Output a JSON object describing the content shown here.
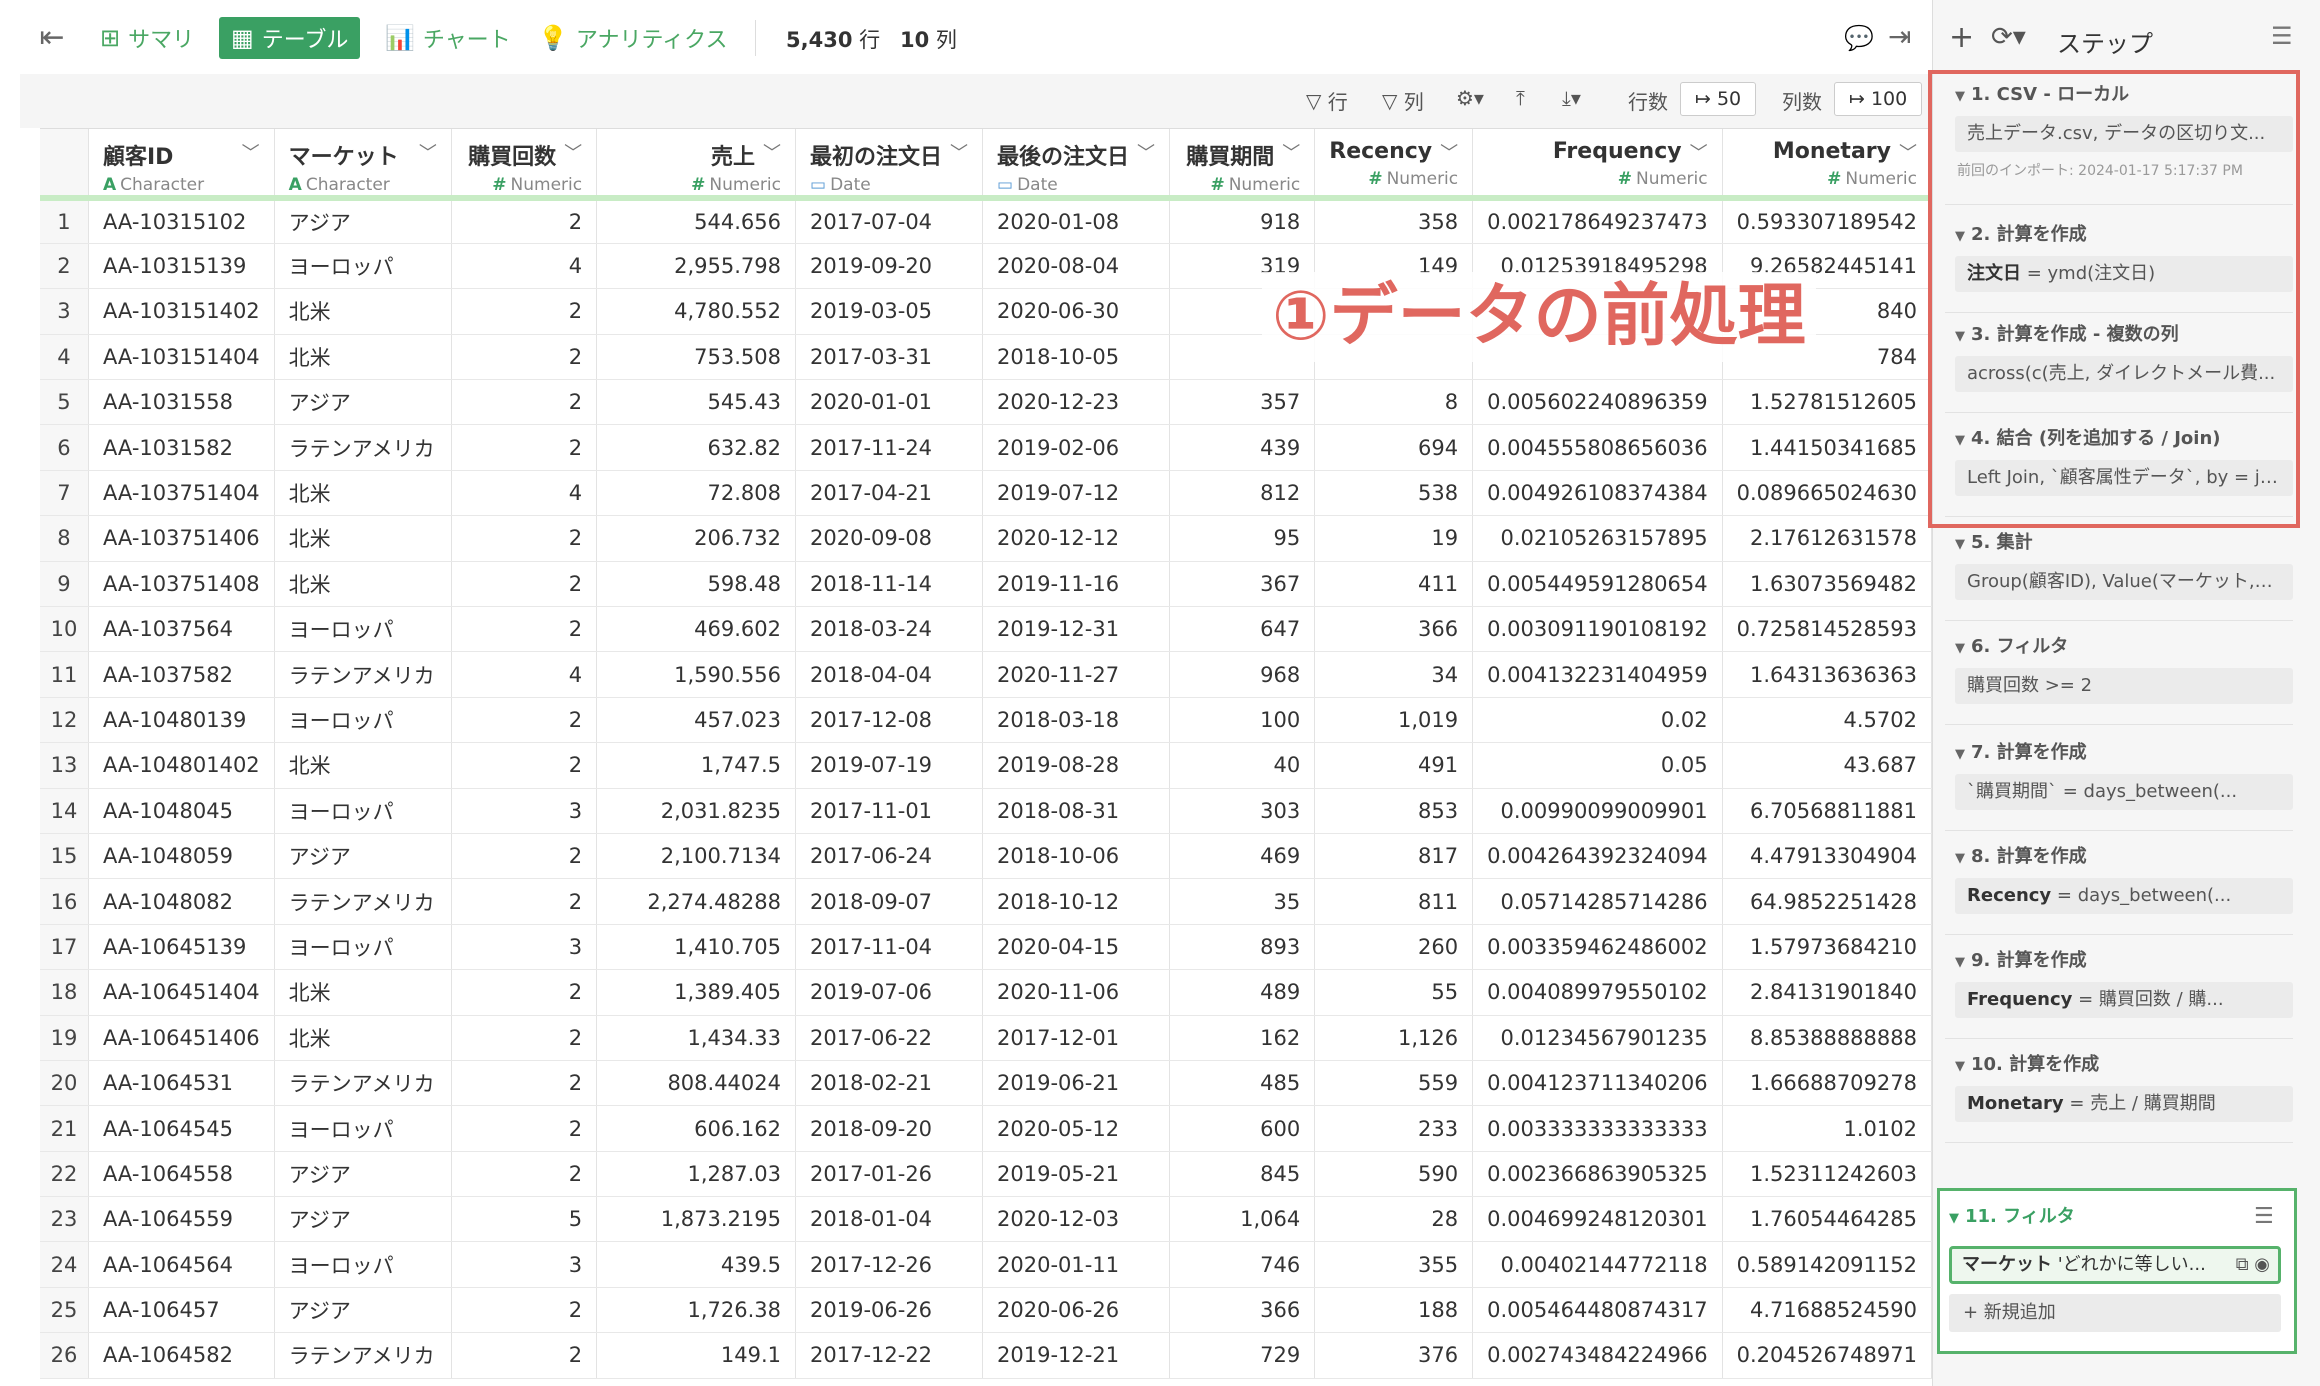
{
  "toolbar": {
    "tabs": [
      {
        "label": "サマリ",
        "icon": "summary-grid-icon"
      },
      {
        "label": "テーブル",
        "icon": "table-icon"
      },
      {
        "label": "チャート",
        "icon": "bar-chart-icon"
      },
      {
        "label": "アナリティクス",
        "icon": "lightbulb-icon"
      }
    ],
    "row_count": "5,430",
    "row_unit": "行",
    "col_count": "10",
    "col_unit": "列"
  },
  "subbar": {
    "row_filter": "行",
    "col_filter": "列",
    "rows_label": "行数",
    "rows_value": "50",
    "cols_label": "列数",
    "cols_value": "100"
  },
  "table": {
    "columns": [
      {
        "name": "顧客ID",
        "type": "Character",
        "num": false
      },
      {
        "name": "マーケット",
        "type": "Character",
        "num": false
      },
      {
        "name": "購買回数",
        "type": "Numeric",
        "num": true
      },
      {
        "name": "売上",
        "type": "Numeric",
        "num": true
      },
      {
        "name": "最初の注文日",
        "type": "Date",
        "num": false
      },
      {
        "name": "最後の注文日",
        "type": "Date",
        "num": false
      },
      {
        "name": "購買期間",
        "type": "Numeric",
        "num": true
      },
      {
        "name": "Recency",
        "type": "Numeric",
        "num": true
      },
      {
        "name": "Frequency",
        "type": "Numeric",
        "num": true
      },
      {
        "name": "Monetary",
        "type": "Numeric",
        "num": true
      }
    ],
    "rows": [
      [
        "1",
        "AA-10315102",
        "アジア",
        "2",
        "544.656",
        "2017-07-04",
        "2020-01-08",
        "918",
        "358",
        "0.002178649237473",
        "0.593307189542"
      ],
      [
        "2",
        "AA-10315139",
        "ヨーロッパ",
        "4",
        "2,955.798",
        "2019-09-20",
        "2020-08-04",
        "319",
        "149",
        "0.01253918495298",
        "9.26582445141"
      ],
      [
        "3",
        "AA-103151402",
        "北米",
        "2",
        "4,780.552",
        "2019-03-05",
        "2020-06-30",
        "",
        "",
        "",
        "840"
      ],
      [
        "4",
        "AA-103151404",
        "北米",
        "2",
        "753.508",
        "2017-03-31",
        "2018-10-05",
        "",
        "",
        "",
        "784"
      ],
      [
        "5",
        "AA-1031558",
        "アジア",
        "2",
        "545.43",
        "2020-01-01",
        "2020-12-23",
        "357",
        "8",
        "0.005602240896359",
        "1.52781512605"
      ],
      [
        "6",
        "AA-1031582",
        "ラテンアメリカ",
        "2",
        "632.82",
        "2017-11-24",
        "2019-02-06",
        "439",
        "694",
        "0.004555808656036",
        "1.44150341685"
      ],
      [
        "7",
        "AA-103751404",
        "北米",
        "4",
        "72.808",
        "2017-04-21",
        "2019-07-12",
        "812",
        "538",
        "0.004926108374384",
        "0.089665024630"
      ],
      [
        "8",
        "AA-103751406",
        "北米",
        "2",
        "206.732",
        "2020-09-08",
        "2020-12-12",
        "95",
        "19",
        "0.02105263157895",
        "2.17612631578"
      ],
      [
        "9",
        "AA-103751408",
        "北米",
        "2",
        "598.48",
        "2018-11-14",
        "2019-11-16",
        "367",
        "411",
        "0.005449591280654",
        "1.63073569482"
      ],
      [
        "10",
        "AA-1037564",
        "ヨーロッパ",
        "2",
        "469.602",
        "2018-03-24",
        "2019-12-31",
        "647",
        "366",
        "0.003091190108192",
        "0.725814528593"
      ],
      [
        "11",
        "AA-1037582",
        "ラテンアメリカ",
        "4",
        "1,590.556",
        "2018-04-04",
        "2020-11-27",
        "968",
        "34",
        "0.004132231404959",
        "1.64313636363"
      ],
      [
        "12",
        "AA-10480139",
        "ヨーロッパ",
        "2",
        "457.023",
        "2017-12-08",
        "2018-03-18",
        "100",
        "1,019",
        "0.02",
        "4.5702"
      ],
      [
        "13",
        "AA-104801402",
        "北米",
        "2",
        "1,747.5",
        "2019-07-19",
        "2019-08-28",
        "40",
        "491",
        "0.05",
        "43.687"
      ],
      [
        "14",
        "AA-1048045",
        "ヨーロッパ",
        "3",
        "2,031.8235",
        "2017-11-01",
        "2018-08-31",
        "303",
        "853",
        "0.00990099009901",
        "6.70568811881"
      ],
      [
        "15",
        "AA-1048059",
        "アジア",
        "2",
        "2,100.7134",
        "2017-06-24",
        "2018-10-06",
        "469",
        "817",
        "0.004264392324094",
        "4.47913304904"
      ],
      [
        "16",
        "AA-1048082",
        "ラテンアメリカ",
        "2",
        "2,274.48288",
        "2018-09-07",
        "2018-10-12",
        "35",
        "811",
        "0.05714285714286",
        "64.9852251428"
      ],
      [
        "17",
        "AA-10645139",
        "ヨーロッパ",
        "3",
        "1,410.705",
        "2017-11-04",
        "2020-04-15",
        "893",
        "260",
        "0.003359462486002",
        "1.57973684210"
      ],
      [
        "18",
        "AA-106451404",
        "北米",
        "2",
        "1,389.405",
        "2019-07-06",
        "2020-11-06",
        "489",
        "55",
        "0.004089979550102",
        "2.84131901840"
      ],
      [
        "19",
        "AA-106451406",
        "北米",
        "2",
        "1,434.33",
        "2017-06-22",
        "2017-12-01",
        "162",
        "1,126",
        "0.01234567901235",
        "8.85388888888"
      ],
      [
        "20",
        "AA-1064531",
        "ラテンアメリカ",
        "2",
        "808.44024",
        "2018-02-21",
        "2019-06-21",
        "485",
        "559",
        "0.004123711340206",
        "1.66688709278"
      ],
      [
        "21",
        "AA-1064545",
        "ヨーロッパ",
        "2",
        "606.162",
        "2018-09-20",
        "2020-05-12",
        "600",
        "233",
        "0.003333333333333",
        "1.0102"
      ],
      [
        "22",
        "AA-1064558",
        "アジア",
        "2",
        "1,287.03",
        "2017-01-26",
        "2019-05-21",
        "845",
        "590",
        "0.002366863905325",
        "1.52311242603"
      ],
      [
        "23",
        "AA-1064559",
        "アジア",
        "5",
        "1,873.2195",
        "2018-01-04",
        "2020-12-03",
        "1,064",
        "28",
        "0.004699248120301",
        "1.76054464285"
      ],
      [
        "24",
        "AA-1064564",
        "ヨーロッパ",
        "3",
        "439.5",
        "2017-12-26",
        "2020-01-11",
        "746",
        "355",
        "0.00402144772118",
        "0.589142091152"
      ],
      [
        "25",
        "AA-106457",
        "アジア",
        "2",
        "1,726.38",
        "2019-06-26",
        "2020-06-26",
        "366",
        "188",
        "0.005464480874317",
        "4.71688524590"
      ],
      [
        "26",
        "AA-1064582",
        "ラテンアメリカ",
        "2",
        "149.1",
        "2017-12-22",
        "2019-12-21",
        "729",
        "376",
        "0.002743484224966",
        "0.204526748971"
      ]
    ]
  },
  "annotation": "①データの前処理",
  "panel": {
    "title": "ステップ",
    "steps": [
      {
        "title": "1. CSV - ローカル",
        "body_bold": "",
        "body": "売上データ.csv, データの区切り文...",
        "meta": "前回のインポート: 2024-01-17 5:17:37 PM"
      },
      {
        "title": "2. 計算を作成",
        "body_bold": "注文日",
        "body": " = ymd(注文日)",
        "meta": ""
      },
      {
        "title": "3. 計算を作成 - 複数の列",
        "body_bold": "",
        "body": "across(c(売上, ダイレクトメール費...",
        "meta": ""
      },
      {
        "title": "4. 結合 (列を追加する / Join)",
        "body_bold": "",
        "body": "Left Join, `顧客属性データ`, by = joi...",
        "meta": ""
      },
      {
        "title": "5. 集計",
        "body_bold": "",
        "body": "Group(顧客ID), Value(マーケット,注...",
        "meta": ""
      },
      {
        "title": "6. フィルタ",
        "body_bold": "",
        "body": "購買回数 >= 2",
        "meta": ""
      },
      {
        "title": "7. 計算を作成",
        "body_bold": "",
        "body": "`購買期間` = days_between(...",
        "meta": ""
      },
      {
        "title": "8. 計算を作成",
        "body_bold": "Recency",
        "body": " = days_between(...",
        "meta": ""
      },
      {
        "title": "9. 計算を作成",
        "body_bold": "Frequency",
        "body": " = 購買回数 / 購...",
        "meta": ""
      },
      {
        "title": "10. 計算を作成",
        "body_bold": "Monetary",
        "body": " = 売上 / 購買期間",
        "meta": ""
      }
    ],
    "active_step": {
      "title": "11. フィルタ",
      "chip_bold": "マーケット",
      "chip_text": " 'どれかに等しい...",
      "add_label": "+ 新規追加"
    }
  }
}
